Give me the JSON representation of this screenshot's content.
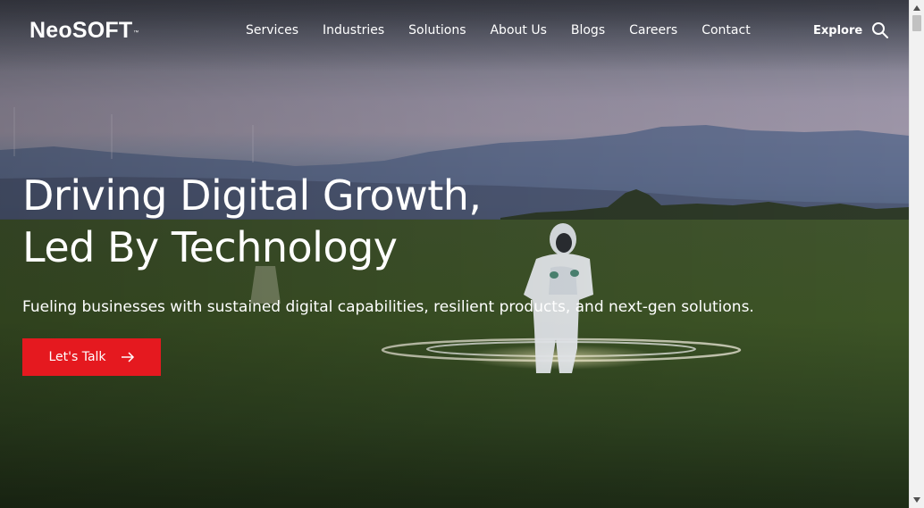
{
  "header": {
    "logo_text": "NeoSOFT",
    "logo_mark": "™",
    "nav": [
      {
        "label": "Services"
      },
      {
        "label": "Industries"
      },
      {
        "label": "Solutions"
      },
      {
        "label": "About Us"
      },
      {
        "label": "Blogs"
      },
      {
        "label": "Careers"
      },
      {
        "label": "Contact"
      }
    ],
    "explore_label": "Explore",
    "search_icon": "search-icon"
  },
  "hero": {
    "headline_line1": "Driving Digital Growth,",
    "headline_line2": "Led By Technology",
    "subheadline": "Fueling businesses with sustained digital capabilities, resilient products, and next-gen solutions.",
    "cta_label": "Let's Talk",
    "cta_icon": "arrow-right-icon",
    "background_image": "person-in-white-suit-on-field-icon"
  },
  "colors": {
    "accent": "#e5191f",
    "text": "#ffffff"
  }
}
